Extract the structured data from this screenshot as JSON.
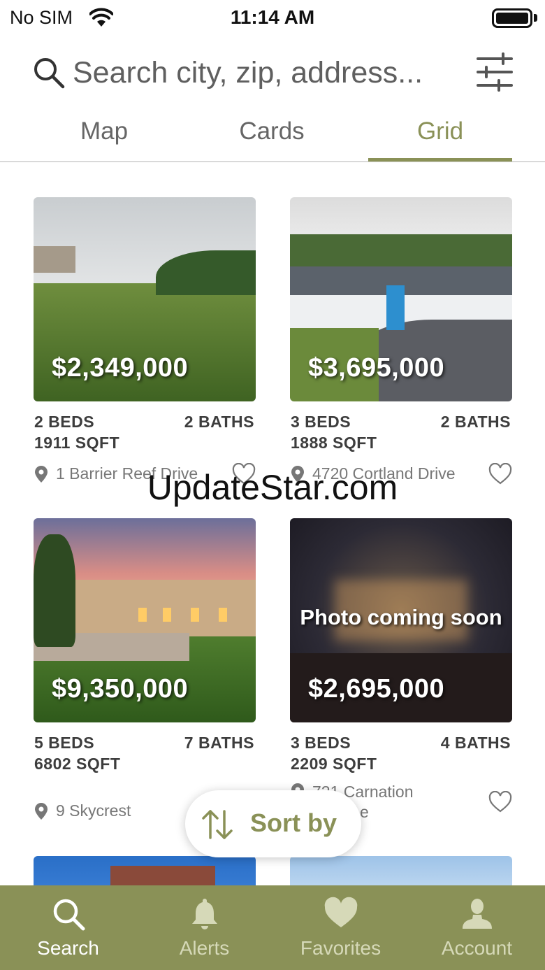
{
  "status_bar": {
    "carrier": "No SIM",
    "time": "11:14 AM"
  },
  "search": {
    "placeholder": "Search city, zip, address..."
  },
  "tabs": [
    {
      "label": "Map",
      "active": false
    },
    {
      "label": "Cards",
      "active": false
    },
    {
      "label": "Grid",
      "active": true
    }
  ],
  "listings": [
    {
      "price": "$2,349,000",
      "beds": "2 BEDS",
      "baths": "2 BATHS",
      "sqft": "1911 SQFT",
      "address": "1 Barrier Reef Drive",
      "photo_note": ""
    },
    {
      "price": "$3,695,000",
      "beds": "3 BEDS",
      "baths": "2 BATHS",
      "sqft": "1888 SQFT",
      "address": "4720 Cortland Drive",
      "photo_note": ""
    },
    {
      "price": "$9,350,000",
      "beds": "5 BEDS",
      "baths": "7 BATHS",
      "sqft": "6802 SQFT",
      "address": "9 Skycrest",
      "photo_note": ""
    },
    {
      "price": "$2,695,000",
      "beds": "3 BEDS",
      "baths": "4 BATHS",
      "sqft": "2209 SQFT",
      "address": "721 Carnation",
      "address_line2": "e",
      "photo_note": "Photo coming soon"
    }
  ],
  "sort": {
    "label": "Sort by"
  },
  "watermark": "UpdateStar.com",
  "bottom_nav": [
    {
      "label": "Search",
      "icon": "search-icon",
      "active": true
    },
    {
      "label": "Alerts",
      "icon": "bell-icon",
      "active": false
    },
    {
      "label": "Favorites",
      "icon": "heart-icon",
      "active": false
    },
    {
      "label": "Account",
      "icon": "person-icon",
      "active": false
    }
  ],
  "colors": {
    "accent": "#8a9157",
    "nav_inactive": "#d6d9b8"
  }
}
